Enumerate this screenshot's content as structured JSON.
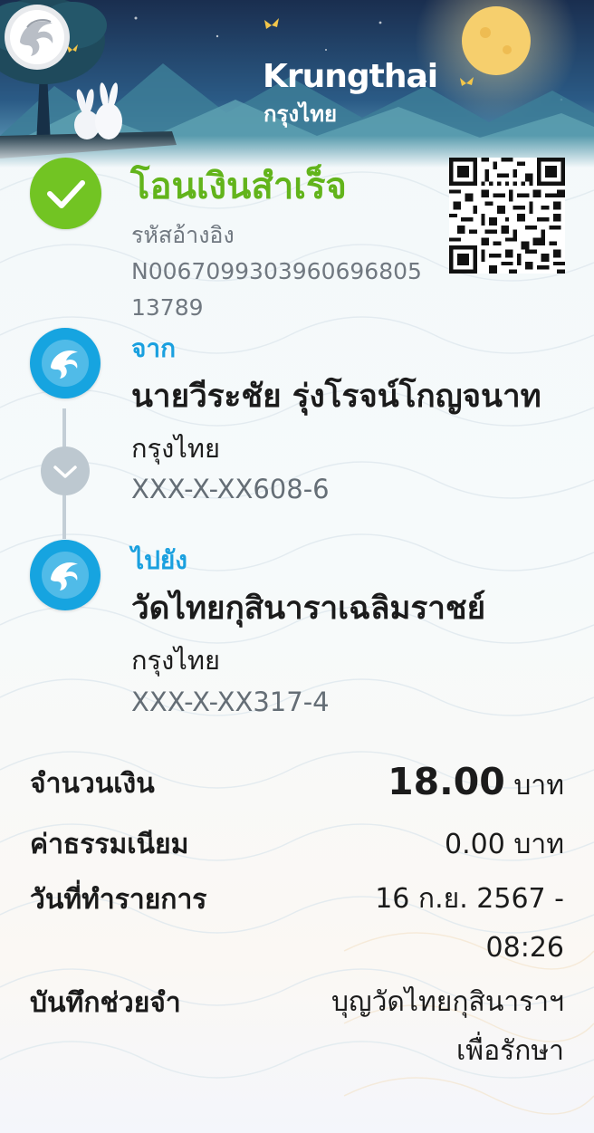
{
  "brand": {
    "name": "Krungthai",
    "name_thai": "กรุงไทย"
  },
  "status": {
    "title": "โอนเงินสำเร็จ",
    "ref_label": "รหัสอ้างอิง",
    "ref_value": "N006709930396069680513789"
  },
  "from": {
    "role": "จาก",
    "name": "นายวีระชัย รุ่งโรจน์โกญจนาท",
    "bank": "กรุงไทย",
    "account": "XXX-X-XX608-6"
  },
  "to": {
    "role": "ไปยัง",
    "name": "วัดไทยกุสินาราเฉลิมราชย์",
    "bank": "กรุงไทย",
    "account": "XXX-X-XX317-4"
  },
  "details": {
    "amount_label": "จำนวนเงิน",
    "amount_value": "18.00",
    "amount_unit": "บาท",
    "fee_label": "ค่าธรรมเนียม",
    "fee_value": "0.00 บาท",
    "datetime_label": "วันที่ทำรายการ",
    "datetime_line1": "16 ก.ย. 2567 -",
    "datetime_line2": "08:26",
    "memo_label": "บันทึกช่วยจำ",
    "memo_line1": "บุญวัดไทยกุสินาราฯ",
    "memo_line2": "เพื่อรักษา"
  },
  "colors": {
    "success_green": "#72c423",
    "title_green": "#62b41b",
    "brand_blue": "#16a4e0",
    "header_night_blue": "#1f3d63"
  },
  "icons": [
    "success-check-icon",
    "qr-code-icon",
    "krungthai-bird-logo-icon",
    "chevron-down-icon"
  ]
}
